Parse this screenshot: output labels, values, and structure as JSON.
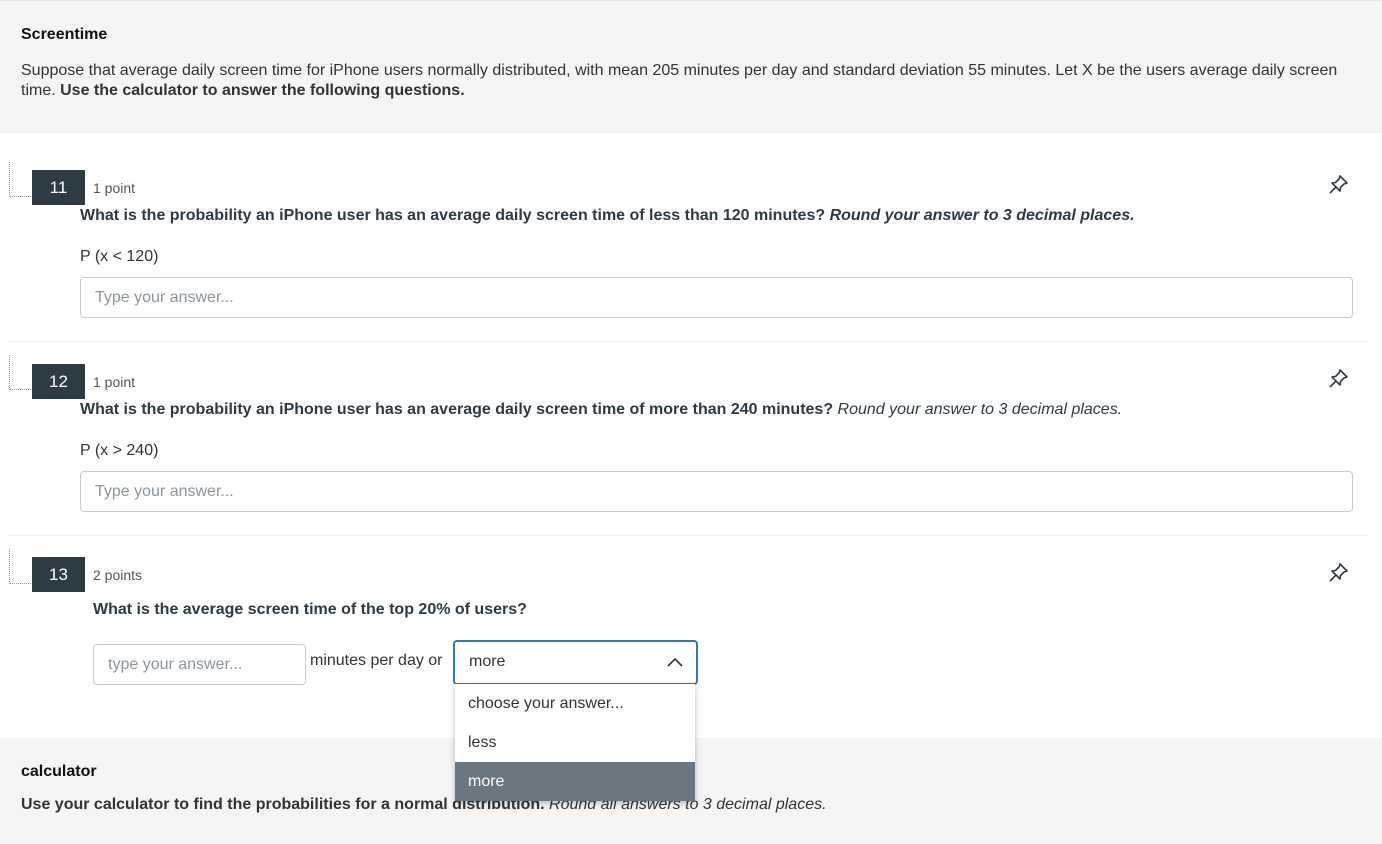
{
  "intro": {
    "title": "Screentime",
    "text_a": "Suppose that average daily screen time for iPhone users normally distributed, with mean 205 minutes per day and standard deviation 55 minutes. Let X be the users average daily screen time. ",
    "text_b": "Use the calculator to answer the following questions."
  },
  "questions": [
    {
      "number": "11",
      "points": "1 point",
      "text": "What is the probability an iPhone user has an average daily screen time of less than 120 minutes? ",
      "note": "Round your answer to 3 decimal places.",
      "label": "P (x < 120)",
      "placeholder": "Type your answer..."
    },
    {
      "number": "12",
      "points": "1 point",
      "text": "What is the probability an iPhone user has an average daily screen time of more than 240 minutes? ",
      "note": "Round your answer to 3 decimal places.",
      "label": "P (x > 240)",
      "placeholder": "Type your answer..."
    },
    {
      "number": "13",
      "points": "2 points",
      "text": "What is the average screen time of the top 20% of users?",
      "input_placeholder": "type your answer...",
      "middle_text": "minutes per day or",
      "select_value": "more",
      "options": [
        "choose your answer...",
        "less",
        "more"
      ]
    }
  ],
  "calculator": {
    "title": "calculator",
    "text_bold": "Use your calculator to find the probabilities for a normal distribution.",
    "text_italic": " Round all answers to 3 decimal places."
  },
  "icons": {
    "pin": "pin-icon",
    "chevron": "chevron-up-icon"
  },
  "colors": {
    "number_badge": "#2d3b45",
    "focus_border": "#2b7abc",
    "selected_option": "#6b7780"
  }
}
